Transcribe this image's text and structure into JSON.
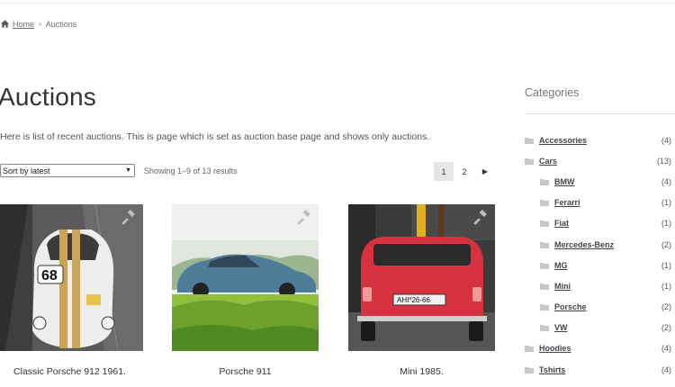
{
  "breadcrumb": {
    "home": "Home",
    "separator": "›",
    "current": "Auctions"
  },
  "page": {
    "title": "Auctions",
    "intro": "Here is list of recent auctions. This is page which is set as auction base page and shows only auctions."
  },
  "toolbar": {
    "sort_value": "Sort by latest",
    "result_count": "Showing 1–9 of 13 results",
    "pages": [
      "1",
      "2"
    ],
    "next": "▶"
  },
  "products": [
    {
      "name": "Classic Porsche 912 1961.",
      "icon": "gavel-icon"
    },
    {
      "name": "Porsche 911",
      "icon": "gavel-icon"
    },
    {
      "name": "Mini 1985.",
      "icon": "gavel-icon"
    }
  ],
  "sidebar": {
    "title": "Categories",
    "categories": [
      {
        "label": "Accessories",
        "count": "(4)"
      },
      {
        "label": "Cars",
        "count": "(13)"
      },
      {
        "label": "BMW",
        "count": "(4)"
      },
      {
        "label": "Ferarri",
        "count": "(1)"
      },
      {
        "label": "Fiat",
        "count": "(1)"
      },
      {
        "label": "Mercedes-Benz",
        "count": "(2)"
      },
      {
        "label": "MG",
        "count": "(1)"
      },
      {
        "label": "Mini",
        "count": "(1)"
      },
      {
        "label": "Porsche",
        "count": "(2)"
      },
      {
        "label": "VW",
        "count": "(2)"
      },
      {
        "label": "Hoodies",
        "count": "(4)"
      },
      {
        "label": "Tshirts",
        "count": "(4)"
      }
    ]
  },
  "colors": {
    "text": "#43454b",
    "muted": "#6d6d6d",
    "pager_active": "#e6e6e6",
    "folder": "#c8c8c8"
  }
}
